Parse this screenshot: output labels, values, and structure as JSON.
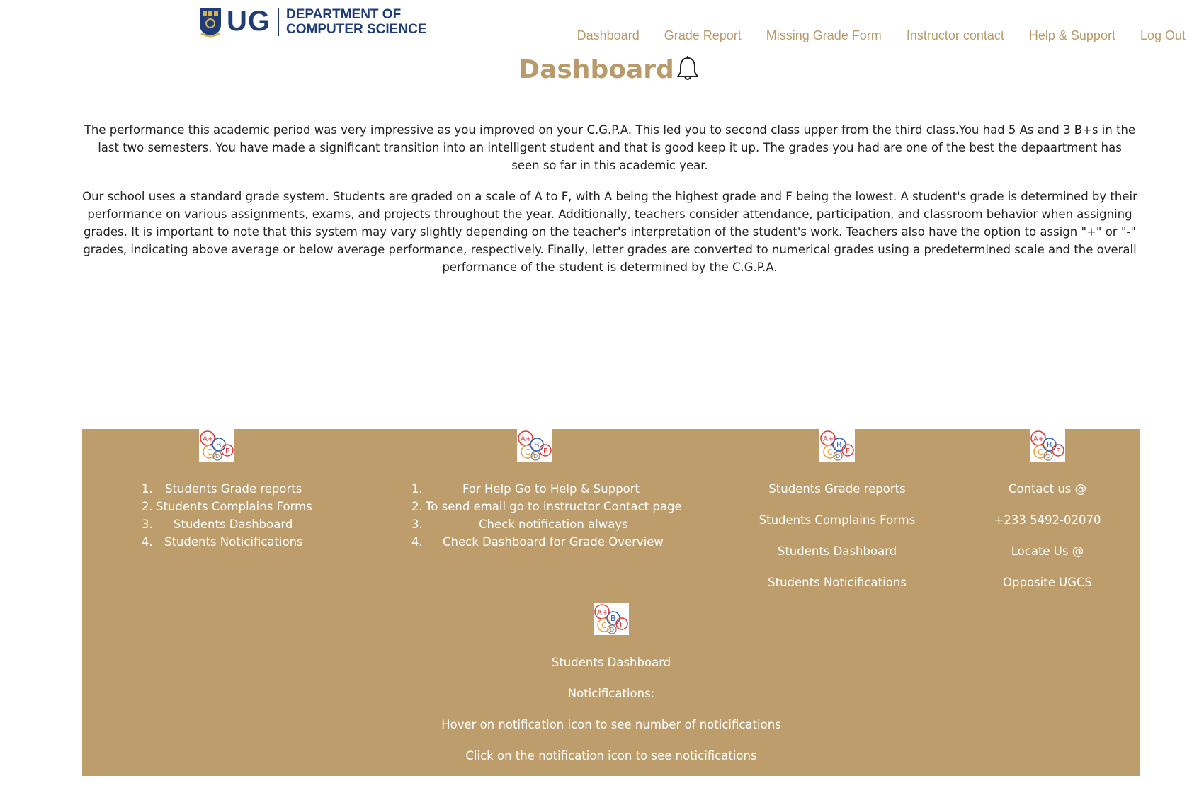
{
  "header": {
    "logo_ug": "UG",
    "logo_dept_line1": "DEPARTMENT OF",
    "logo_dept_line2": "COMPUTER SCIENCE"
  },
  "nav": {
    "items": [
      {
        "label": "Dashboard"
      },
      {
        "label": "Grade Report"
      },
      {
        "label": "Missing Grade Form"
      },
      {
        "label": "Instructor contact"
      },
      {
        "label": "Help & Support"
      },
      {
        "label": "Log Out"
      }
    ]
  },
  "main": {
    "title": "Dashboard",
    "paragraph1": "The performance this academic period was very impressive as you improved on your C.G.P.A. This led you to second class upper from the third class.You had 5 As and 3 B+s in the last two semesters. You have made a significant transition into an intelligent student and that is good keep it up. The grades you had are one of the best the depaartment has seen so far in this academic year.",
    "paragraph2": "Our school uses a standard grade system. Students are graded on a scale of A to F, with A being the highest grade and F being the lowest. A student's grade is determined by their performance on various assignments, exams, and projects throughout the year. Additionally, teachers consider attendance, participation, and classroom behavior when assigning grades. It is important to note that this system may vary slightly depending on the teacher's interpretation of the student's work. Teachers also have the option to assign \"+\" or \"-\" grades, indicating above average or below average performance, respectively. Finally, letter grades are converted to numerical grades using a predetermined scale and the overall performance of the student is determined by the C.G.P.A."
  },
  "footer": {
    "col1": [
      {
        "num": "1.",
        "text": "Students Grade reports"
      },
      {
        "num": "2.",
        "text": "Students Complains Forms"
      },
      {
        "num": "3.",
        "text": "Students Dashboard"
      },
      {
        "num": "4.",
        "text": "Students Noticifications"
      }
    ],
    "col2": [
      {
        "num": "1.",
        "text": "For Help Go to Help & Support"
      },
      {
        "num": "2.",
        "text": "To send email go to instructor Contact page"
      },
      {
        "num": "3.",
        "text": "Check notification always"
      },
      {
        "num": "4.",
        "text": "Check Dashboard for Grade Overview"
      }
    ],
    "col3": [
      "Students Grade reports",
      "Students Complains Forms",
      "Students Dashboard",
      "Students Noticifications"
    ],
    "col4": [
      "Contact us @",
      "+233 5492-02070",
      "Locate Us @",
      "Opposite UGCS"
    ],
    "bottom": [
      "Students Dashboard",
      "Noticifications:",
      "Hover on notification icon to see number of noticifications",
      "Click on the notification icon to see noticifications"
    ],
    "badge_letters": [
      "A+",
      "C",
      "B",
      "F",
      "D"
    ]
  },
  "colors": {
    "accent": "#bc9d6b",
    "nav_text": "#b99a6a",
    "logo_blue": "#1f3c78"
  },
  "icons": {
    "bell": "bell-icon",
    "badge": "grades-badge-icon",
    "crest": "ug-crest-icon"
  }
}
